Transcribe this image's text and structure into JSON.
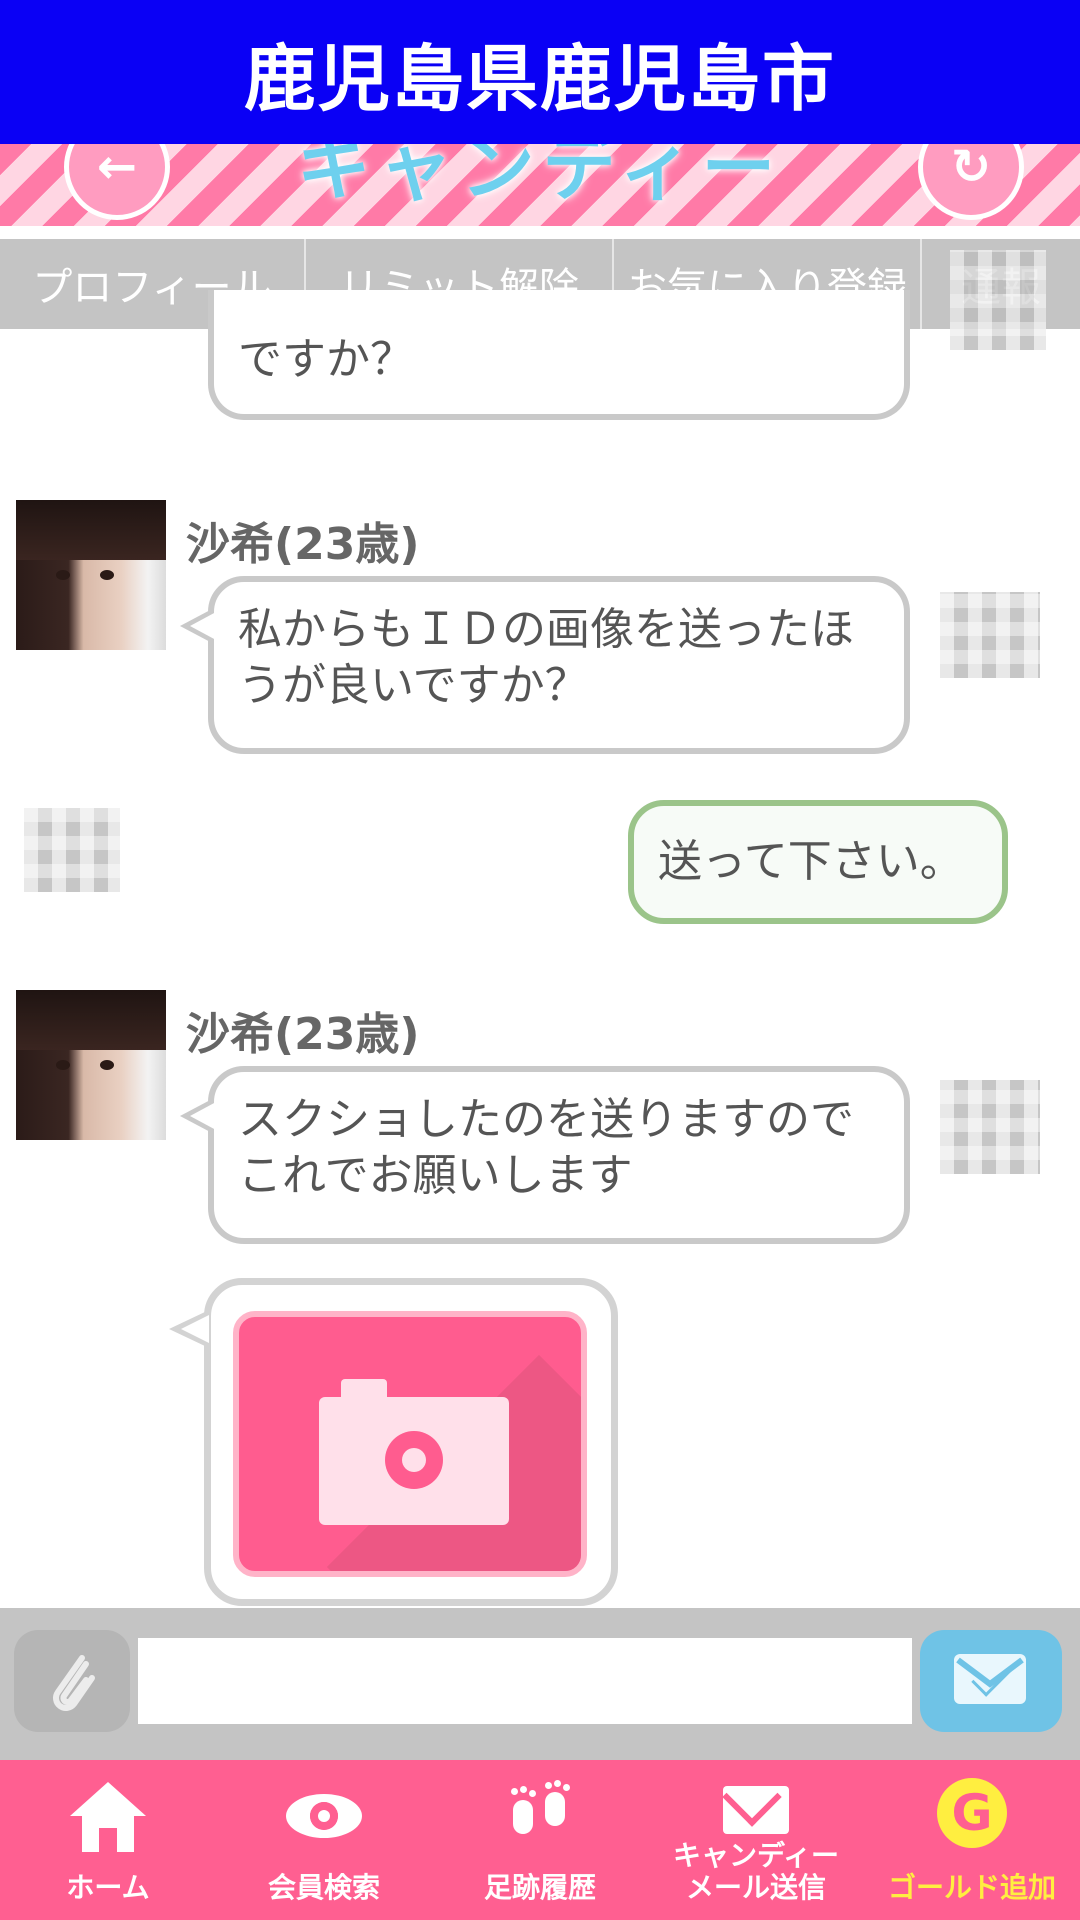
{
  "page_title": "鹿児島県鹿児島市",
  "header": {
    "logo_text": "キャンディー",
    "back_icon": "arrow-left-icon",
    "reload_icon": "reload-icon"
  },
  "tabs": [
    {
      "label": "プロフィール"
    },
    {
      "label": "リミット解除"
    },
    {
      "label": "お気に入り登録"
    },
    {
      "label": "通報"
    }
  ],
  "messages": [
    {
      "sender": "",
      "text": "ですか？"
    },
    {
      "sender": "沙希(23歳)",
      "text_line1": "私からもＩＤの画像を送ったほ",
      "text_line2": "うが良いですか？"
    },
    {
      "sender": "me",
      "text": "送って下さい。"
    },
    {
      "sender": "沙希(23歳)",
      "text_line1": "スクショしたのを送りますので",
      "text_line2": "これでお願いします"
    },
    {
      "sender": "沙希(23歳)",
      "attachment": "camera-icon"
    }
  ],
  "composer": {
    "value": "",
    "placeholder": ""
  },
  "bottom_nav": [
    {
      "label": "ホーム",
      "icon": "home-icon"
    },
    {
      "label": "会員検索",
      "icon": "eye-icon"
    },
    {
      "label": "足跡履歴",
      "icon": "footprints-icon"
    },
    {
      "label_line1": "キャンディー",
      "label_line2": "メール送信",
      "icon": "mail-icon"
    },
    {
      "label": "ゴールド追加",
      "icon": "g-coin-icon",
      "icon_letter": "G"
    }
  ],
  "colors": {
    "title_bar": "#0a00f5",
    "nav_bg": "#ff5f91",
    "gold_label": "#ffee40",
    "my_bubble_border": "#9bc48a",
    "send_button": "#6fc3e6"
  }
}
